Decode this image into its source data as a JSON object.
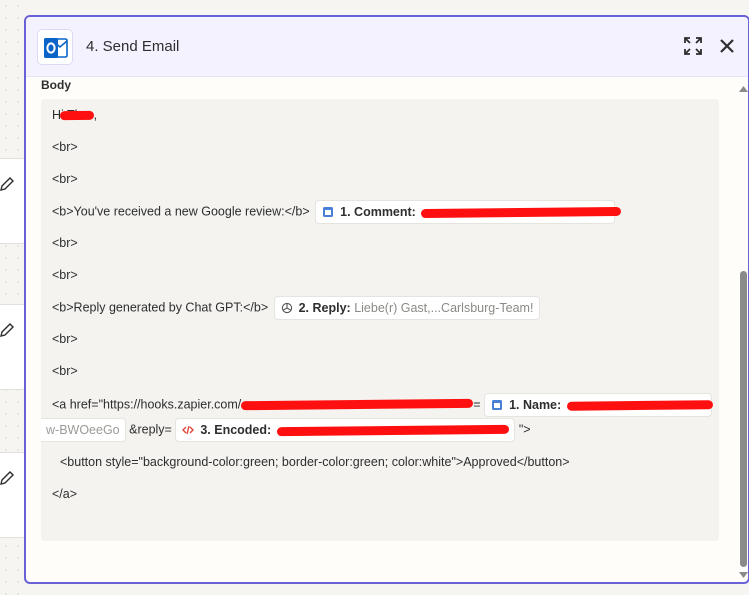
{
  "modal": {
    "title": "4. Send Email",
    "body_label": "Body"
  },
  "editor": {
    "greeting_prefix": "Hi Th",
    "greeting_suffix": ",",
    "br": "<br>",
    "review_intro": "<b>You've received a new Google review:</b>",
    "comment_pill": {
      "label": "1. Comment:"
    },
    "reply_intro": "<b>Reply generated by Chat GPT:</b>",
    "reply_pill": {
      "label": "2. Reply:",
      "value": "Liebe(r) Gast,...Carlsburg-Team!"
    },
    "href_prefix": "<a href=\"https://hooks.zapier.com/",
    "href_eq": "=",
    "name_pill": {
      "label": "1. Name:"
    },
    "name_overflow": "w-BWOeeGo",
    "reply_param": "&reply=",
    "encoded_pill": {
      "label": "3. Encoded:"
    },
    "href_close": "\">",
    "button_line": "<button style=\"background-color:green; border-color:green; color:white\">Approved</button>",
    "close_a": "</a>"
  },
  "colors": {
    "accent": "#6a61d6",
    "outlook_blue": "#0a64c8",
    "redaction": "#ff1010",
    "code_icon": "#e0463a"
  },
  "icons": {
    "app": "outlook-icon",
    "expand": "expand-icon",
    "close": "close-icon",
    "comment": "google-business-icon",
    "reply": "openai-icon",
    "encoded": "code-icon",
    "edit": "pencil-icon"
  }
}
